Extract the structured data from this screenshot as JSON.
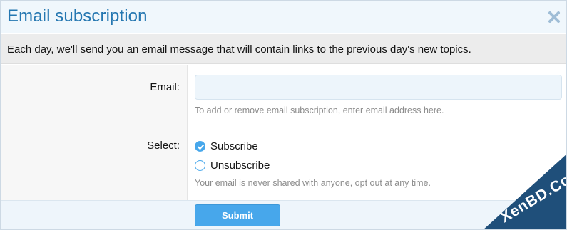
{
  "dialog": {
    "title": "Email subscription",
    "close_icon": "close-x-icon",
    "description": "Each day, we'll send you an email message that will contain links to the previous day's new topics."
  },
  "form": {
    "email_label": "Email:",
    "email_value": "",
    "email_hint": "To add or remove email subscription, enter email address here.",
    "select_label": "Select:",
    "options": [
      {
        "label": "Subscribe",
        "checked": true
      },
      {
        "label": "Unsubscribe",
        "checked": false
      }
    ],
    "privacy_note": "Your email is never shared with anyone, opt out at any time.",
    "submit_label": "Submit"
  },
  "watermark": {
    "text": "XenBD.Com"
  },
  "colors": {
    "accent": "#47a7eb",
    "title": "#2577b1",
    "header_bg": "#f0f7fc",
    "watermark": "#1f4f7a"
  }
}
